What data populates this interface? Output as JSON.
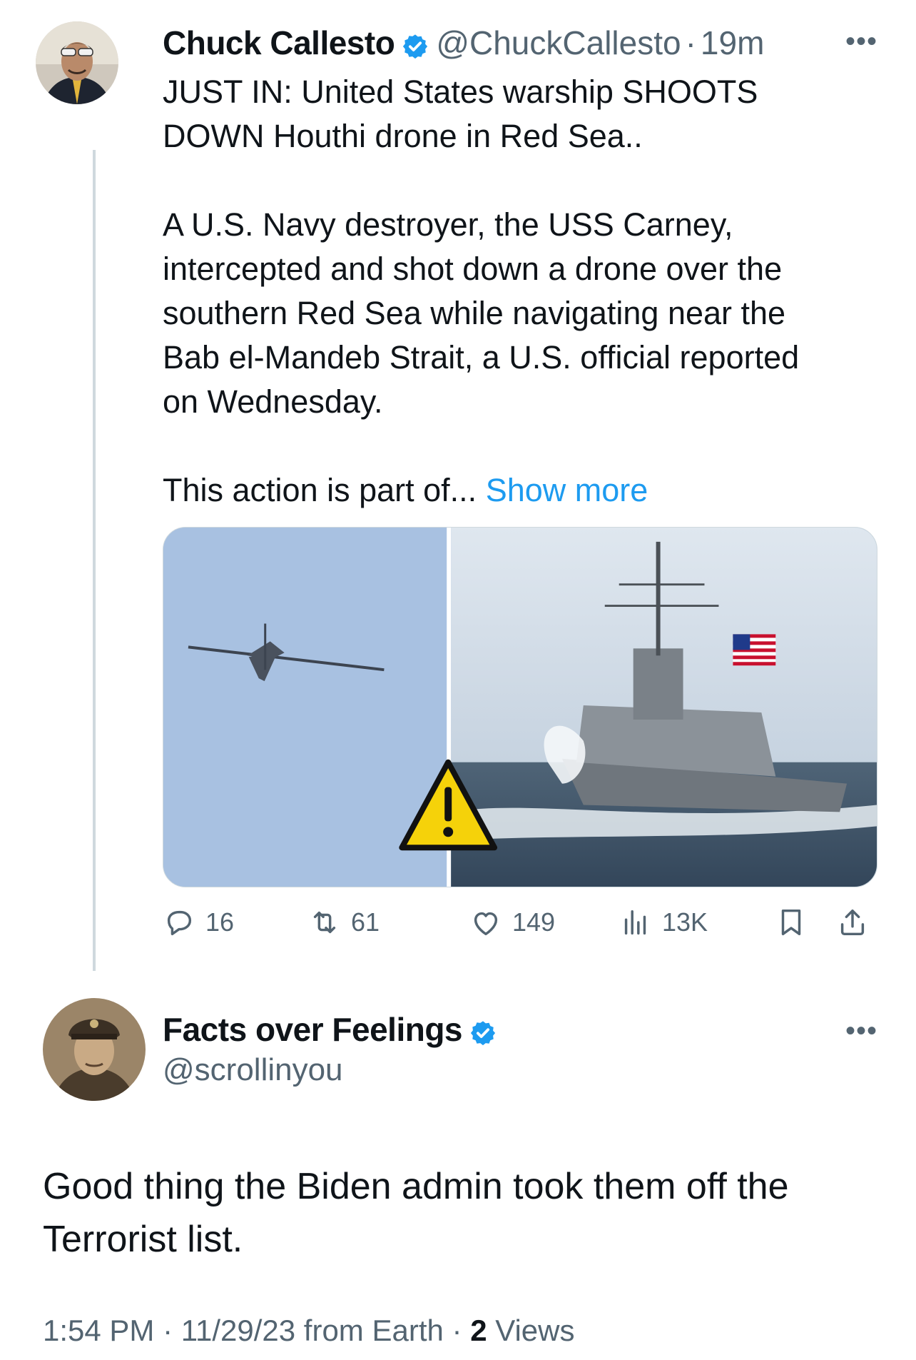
{
  "colors": {
    "accent": "#1d9bf0",
    "muted_text": "#536471",
    "primary_text": "#0f1419",
    "thread_line": "#cfd9de"
  },
  "original_tweet": {
    "author_name": "Chuck Callesto",
    "verified": true,
    "handle": "@ChuckCallesto",
    "separator": "·",
    "time_ago": "19m",
    "more_icon": "more-dots-icon",
    "text_lines": {
      "p1": "JUST IN: United States warship SHOOTS\nDOWN Houthi drone in Red Sea..",
      "p2": "A U.S. Navy destroyer, the USS Carney,\nintercepted and shot down a drone over the\nsouthern Red Sea while navigating near the\nBab el-Mandeb Strait, a U.S. official reported\non Wednesday.",
      "p3": "This action is part of... "
    },
    "show_more_label": "Show more",
    "media": {
      "left_image": "drone-in-sky",
      "right_image": "navy-destroyer-at-sea",
      "overlay_icon": "warning-triangle-icon"
    },
    "actions": {
      "replies": "16",
      "reposts": "61",
      "likes": "149",
      "views": "13K"
    }
  },
  "reply_tweet": {
    "author_name": "Facts over Feelings",
    "verified": true,
    "handle": "@scrollinyou",
    "more_icon": "more-dots-icon",
    "text": "Good thing the Biden admin took them off the\nTerrorist list.",
    "meta": {
      "time": "1:54 PM",
      "date": "11/29/23",
      "source": "from Earth",
      "views_count": "2",
      "views_label": "Views"
    }
  }
}
